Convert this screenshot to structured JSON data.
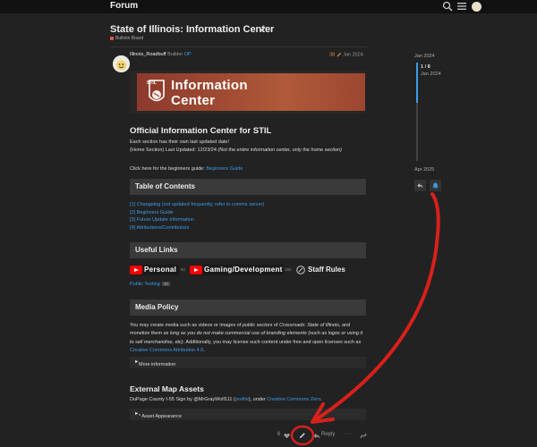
{
  "header": {
    "title": "Forum"
  },
  "topic": {
    "title": "State of Illinois: Information Center",
    "category": "Bulletin Board"
  },
  "post": {
    "author": "Illinois_Roadbuff",
    "user_title": "Builder",
    "op_badge": "OP",
    "edit_count": "38",
    "date": "Jan 2024",
    "banner": {
      "small_text": "STIL",
      "title_line1": "Information",
      "title_line2": "Center"
    },
    "heading": "Official Information Center for STIL",
    "intro": "Each section has their own last updated date!",
    "last_updated": "(Home Section) Last Updated: 12/23/24",
    "last_updated_note": "(Not the entire information center, only the home section)",
    "beginners_prefix": "Click here for the beginners guide:",
    "beginners_link": "Beginners Guide",
    "toc_heading": "Table of Contents",
    "toc_items": [
      "[1] Changelog (not updated frequently, refer to comms server)",
      "[2] Beginners Guide",
      "[3] Future Update Information",
      "[4] Attributions/Contributors"
    ],
    "links_heading": "Useful Links",
    "links": [
      {
        "label": "Personal",
        "count": "82"
      },
      {
        "label": "Gaming/Development",
        "count": "150"
      }
    ],
    "staff_rules": "Staff Rules",
    "public_testing": "Public Testing",
    "public_testing_count": "38",
    "media_heading": "Media Policy",
    "media_text": {
      "a": "You may create media such as videos or images of ",
      "b": "public sectors",
      "c": " of ",
      "d": "Crossroads: State of Illinois",
      "e": ", and monetize them ",
      "f": "as long as you do not make commercial use of branding elements (such as logos or using it to sell merchandise, etc)",
      "g": ". Additionally, you may license such content under free and open licenses such as ",
      "h": "Creative Commons Attribution 4.0",
      "i": "."
    },
    "more_info": "More information",
    "map_heading": "External Map Assets",
    "dupage": {
      "a": "DuPage County I-55 Sign by @MrGrayWolf111 (",
      "b": "profile",
      "c": "), under ",
      "d": "Creative Commons Zero",
      "e": "."
    },
    "asset_appearance": "* Asset Appearance",
    "likes": "6",
    "reply": "Reply"
  },
  "timeline": {
    "start_date": "Jan 2024",
    "progress": "1 / 8",
    "progress_date": "Jan 2024",
    "end_date": "Apr 2025"
  },
  "colors": {
    "accent": "#3d9be9",
    "category": "#e45735",
    "annotation": "#d8201c"
  }
}
